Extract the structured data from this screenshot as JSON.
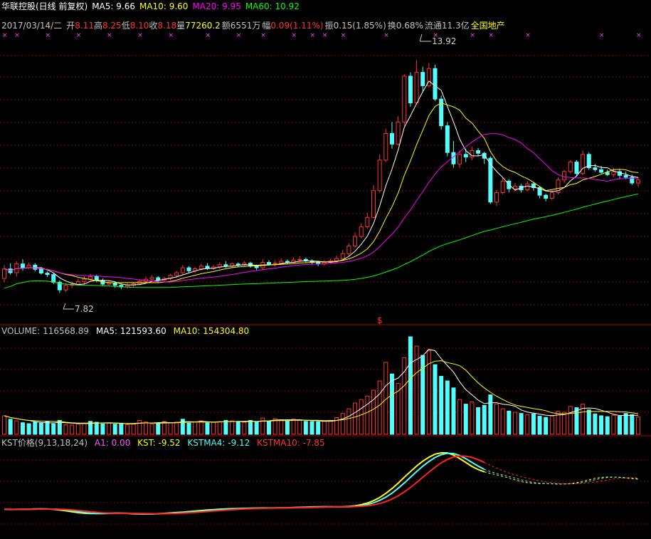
{
  "colors": {
    "up": "#ff3232",
    "down": "#54fcfc",
    "ma5": "#ffffff",
    "ma10": "#ffff00",
    "ma20": "#ff00ff",
    "ma60": "#00ff00",
    "grid": "#8a0000",
    "sep": "#b00000",
    "kst": "#ffff00",
    "kstma4": "#54fcfc",
    "kstma10": "#ff2020",
    "a1": "#ff55ff"
  },
  "header": {
    "stock_name": "华联控股(日线 前复权)",
    "ma5_label": "MA5:",
    "ma5_value": "9.66",
    "ma10_label": "MA10:",
    "ma10_value": "9.60",
    "ma20_label": "MA20:",
    "ma20_value": "9.95",
    "ma60_label": "MA60:",
    "ma60_value": "10.92"
  },
  "info_bar": {
    "date": "2017/03/14/二",
    "open_label": "开",
    "open": "8.11",
    "high_label": "高",
    "high": "8.25",
    "low_label": "低",
    "low": "8.10",
    "close_label": "收",
    "close": "8.18",
    "vol_label": "量",
    "vol": "77260.2",
    "amount": "额6551万",
    "change_label": "幅",
    "change": "0.09(1.11%)",
    "amplitude": "振0.15(1.85%)",
    "turnover": "换0.68%",
    "float": "流通11.3亿",
    "sector": "全国地产"
  },
  "volume_header": {
    "label": "VOLUME: 116568.89",
    "ma5": "MA5: 121593.60",
    "ma10": "MA10: 154304.80"
  },
  "kst_header": {
    "label": "KST价格(9,13,18,24)",
    "a1": "A1: 0.00",
    "kst": "KST: -9.52",
    "kstma4": "KSTMA4: -9.12",
    "kstma10": "KSTMA10: -7.85"
  },
  "annotations": {
    "max_label": "13.92",
    "min_label": "7.82",
    "signal_symbol": "$"
  },
  "chart_data": {
    "type": "candlestick",
    "price_range": [
      7.1,
      14.6
    ],
    "max_price": 13.92,
    "min_price": 7.82,
    "signals": [
      0,
      2,
      7,
      12,
      17,
      22,
      27,
      33,
      38,
      42,
      47,
      50,
      52,
      55,
      62,
      70,
      76,
      79,
      85,
      97,
      103
    ],
    "candles": [
      [
        8.2,
        8.45,
        8.55,
        8.1
      ],
      [
        8.45,
        8.35,
        8.6,
        8.3
      ],
      [
        8.35,
        8.58,
        8.65,
        8.25
      ],
      [
        8.58,
        8.48,
        8.7,
        8.4
      ],
      [
        8.48,
        8.55,
        8.62,
        8.44
      ],
      [
        8.55,
        8.44,
        8.6,
        8.38
      ],
      [
        8.44,
        8.34,
        8.5,
        8.3
      ],
      [
        8.34,
        8.3,
        8.38,
        8.24
      ],
      [
        8.3,
        8.1,
        8.35,
        8.05
      ],
      [
        8.1,
        7.9,
        8.15,
        7.82
      ],
      [
        7.9,
        8.02,
        8.08,
        7.85
      ],
      [
        8.02,
        8.05,
        8.12,
        7.95
      ],
      [
        8.05,
        8.12,
        8.2,
        8.0
      ],
      [
        8.12,
        8.18,
        8.25,
        8.05
      ],
      [
        8.18,
        8.25,
        8.32,
        8.12
      ],
      [
        8.25,
        8.15,
        8.3,
        8.1
      ],
      [
        8.15,
        8.05,
        8.2,
        8.0
      ],
      [
        8.05,
        8.08,
        8.15,
        8.0
      ],
      [
        8.08,
        8.02,
        8.12,
        7.96
      ],
      [
        8.02,
        7.98,
        8.06,
        7.92
      ],
      [
        7.98,
        8.02,
        8.08,
        7.93
      ],
      [
        8.02,
        8.06,
        8.1,
        7.98
      ],
      [
        8.06,
        8.12,
        8.18,
        8.02
      ],
      [
        8.12,
        8.18,
        8.25,
        8.1
      ],
      [
        8.18,
        8.22,
        8.28,
        8.12
      ],
      [
        8.22,
        8.15,
        8.26,
        8.1
      ],
      [
        8.15,
        8.2,
        8.25,
        8.12
      ],
      [
        8.2,
        8.28,
        8.32,
        8.15
      ],
      [
        8.28,
        8.35,
        8.4,
        8.22
      ],
      [
        8.35,
        8.48,
        8.55,
        8.3
      ],
      [
        8.48,
        8.4,
        8.52,
        8.36
      ],
      [
        8.4,
        8.45,
        8.5,
        8.34
      ],
      [
        8.45,
        8.52,
        8.58,
        8.4
      ],
      [
        8.52,
        8.46,
        8.6,
        8.42
      ],
      [
        8.46,
        8.5,
        8.55,
        8.42
      ],
      [
        8.5,
        8.56,
        8.62,
        8.45
      ],
      [
        8.56,
        8.52,
        8.65,
        8.48
      ],
      [
        8.52,
        8.58,
        8.62,
        8.48
      ],
      [
        8.58,
        8.55,
        8.62,
        8.5
      ],
      [
        8.55,
        8.6,
        8.66,
        8.52
      ],
      [
        8.6,
        8.52,
        8.64,
        8.48
      ],
      [
        8.52,
        8.48,
        8.56,
        8.4
      ],
      [
        8.48,
        8.62,
        8.7,
        8.42
      ],
      [
        8.62,
        8.58,
        8.68,
        8.54
      ],
      [
        8.58,
        8.6,
        8.66,
        8.52
      ],
      [
        8.6,
        8.65,
        8.72,
        8.56
      ],
      [
        8.65,
        8.62,
        8.7,
        8.58
      ],
      [
        8.62,
        8.68,
        8.75,
        8.6
      ],
      [
        8.68,
        8.7,
        8.78,
        8.64
      ],
      [
        8.7,
        8.66,
        8.75,
        8.62
      ],
      [
        8.66,
        8.62,
        8.7,
        8.56
      ],
      [
        8.62,
        8.58,
        8.66,
        8.52
      ],
      [
        8.58,
        8.62,
        8.68,
        8.54
      ],
      [
        8.62,
        8.66,
        8.72,
        8.58
      ],
      [
        8.66,
        8.72,
        8.8,
        8.62
      ],
      [
        8.72,
        8.85,
        8.95,
        8.7
      ],
      [
        8.85,
        9.05,
        9.12,
        8.8
      ],
      [
        9.05,
        9.3,
        9.4,
        9.0
      ],
      [
        9.3,
        9.55,
        9.65,
        9.25
      ],
      [
        9.55,
        9.8,
        9.92,
        9.5
      ],
      [
        9.8,
        10.5,
        10.65,
        9.78
      ],
      [
        10.5,
        11.3,
        11.45,
        10.45
      ],
      [
        11.3,
        12.0,
        12.12,
        11.25
      ],
      [
        12.0,
        11.72,
        12.3,
        11.6
      ],
      [
        11.72,
        12.3,
        12.45,
        11.68
      ],
      [
        12.3,
        13.5,
        13.55,
        12.2
      ],
      [
        13.5,
        12.8,
        13.6,
        12.7
      ],
      [
        12.8,
        13.6,
        13.92,
        12.75
      ],
      [
        13.6,
        13.25,
        13.75,
        13.1
      ],
      [
        13.25,
        13.7,
        13.85,
        13.2
      ],
      [
        13.7,
        12.9,
        13.8,
        12.85
      ],
      [
        12.9,
        12.2,
        13.0,
        12.1
      ],
      [
        12.2,
        11.5,
        12.3,
        11.4
      ],
      [
        11.5,
        11.2,
        11.8,
        11.1
      ],
      [
        11.2,
        11.45,
        11.55,
        11.1
      ],
      [
        11.45,
        11.38,
        11.6,
        11.25
      ],
      [
        11.38,
        11.55,
        11.65,
        11.3
      ],
      [
        11.55,
        11.48,
        11.62,
        11.4
      ],
      [
        11.48,
        11.35,
        11.52,
        11.2
      ],
      [
        11.35,
        10.2,
        11.4,
        10.15
      ],
      [
        10.2,
        10.45,
        10.52,
        10.1
      ],
      [
        10.45,
        10.75,
        10.85,
        10.4
      ],
      [
        10.75,
        10.55,
        10.8,
        10.45
      ],
      [
        10.55,
        10.62,
        10.7,
        10.48
      ],
      [
        10.62,
        10.52,
        10.68,
        10.45
      ],
      [
        10.52,
        10.68,
        10.75,
        10.48
      ],
      [
        10.68,
        10.58,
        10.72,
        10.5
      ],
      [
        10.58,
        10.38,
        10.62,
        10.3
      ],
      [
        10.38,
        10.3,
        10.42,
        10.22
      ],
      [
        10.3,
        10.45,
        10.5,
        10.25
      ],
      [
        10.45,
        10.78,
        10.85,
        10.4
      ],
      [
        10.78,
        11.0,
        11.05,
        10.7
      ],
      [
        11.0,
        11.25,
        11.3,
        10.95
      ],
      [
        11.25,
        10.95,
        11.3,
        10.9
      ],
      [
        10.95,
        11.45,
        11.55,
        10.9
      ],
      [
        11.45,
        11.1,
        11.5,
        11.05
      ],
      [
        11.1,
        11.05,
        11.2,
        11.0
      ],
      [
        11.05,
        10.98,
        11.15,
        10.95
      ],
      [
        10.98,
        10.92,
        11.05,
        10.88
      ],
      [
        10.92,
        11.0,
        11.1,
        10.85
      ],
      [
        11.0,
        10.9,
        11.05,
        10.8
      ],
      [
        10.9,
        10.85,
        11.0,
        10.8
      ],
      [
        10.85,
        10.7,
        10.92,
        10.65
      ],
      [
        10.7,
        10.78,
        10.85,
        10.6
      ]
    ],
    "volumes": [
      [
        8.0,
        1
      ],
      [
        6.5,
        -1
      ],
      [
        5.8,
        1
      ],
      [
        5.0,
        -1
      ],
      [
        4.6,
        -1
      ],
      [
        5.2,
        -1
      ],
      [
        4.8,
        -1
      ],
      [
        5.5,
        -1
      ],
      [
        4.5,
        -1
      ],
      [
        6.0,
        -1
      ],
      [
        4.2,
        1
      ],
      [
        4.0,
        1
      ],
      [
        4.5,
        1
      ],
      [
        4.8,
        1
      ],
      [
        5.6,
        -1
      ],
      [
        5.2,
        -1
      ],
      [
        4.5,
        -1
      ],
      [
        4.9,
        1
      ],
      [
        4.4,
        -1
      ],
      [
        4.8,
        -1
      ],
      [
        4.1,
        1
      ],
      [
        4.5,
        1
      ],
      [
        6.0,
        1
      ],
      [
        5.3,
        1
      ],
      [
        4.4,
        1
      ],
      [
        4.9,
        -1
      ],
      [
        5.5,
        1
      ],
      [
        5.0,
        1
      ],
      [
        5.3,
        1
      ],
      [
        6.5,
        -1
      ],
      [
        4.8,
        -1
      ],
      [
        5.3,
        1
      ],
      [
        5.8,
        1
      ],
      [
        4.9,
        -1
      ],
      [
        5.2,
        1
      ],
      [
        5.5,
        1
      ],
      [
        6.0,
        -1
      ],
      [
        5.8,
        1
      ],
      [
        5.4,
        -1
      ],
      [
        5.2,
        1
      ],
      [
        6.0,
        -1
      ],
      [
        5.4,
        -1
      ],
      [
        7.0,
        1
      ],
      [
        5.6,
        -1
      ],
      [
        6.8,
        1
      ],
      [
        6.3,
        1
      ],
      [
        5.7,
        -1
      ],
      [
        6.6,
        1
      ],
      [
        6.1,
        1
      ],
      [
        5.6,
        -1
      ],
      [
        5.5,
        -1
      ],
      [
        5.4,
        -1
      ],
      [
        5.6,
        1
      ],
      [
        6.0,
        1
      ],
      [
        7.2,
        1
      ],
      [
        9.0,
        1
      ],
      [
        11.0,
        1
      ],
      [
        13.5,
        1
      ],
      [
        15.0,
        1
      ],
      [
        16.5,
        1
      ],
      [
        19.0,
        1
      ],
      [
        23.0,
        1
      ],
      [
        31.0,
        1
      ],
      [
        26.0,
        -1
      ],
      [
        22.0,
        1
      ],
      [
        33.0,
        1
      ],
      [
        42.0,
        -1
      ],
      [
        38.0,
        1
      ],
      [
        34.0,
        -1
      ],
      [
        36.0,
        1
      ],
      [
        30.0,
        -1
      ],
      [
        25.0,
        -1
      ],
      [
        23.0,
        -1
      ],
      [
        20.0,
        -1
      ],
      [
        15.0,
        1
      ],
      [
        13.0,
        -1
      ],
      [
        14.0,
        1
      ],
      [
        11.5,
        -1
      ],
      [
        12.5,
        -1
      ],
      [
        17.0,
        -1
      ],
      [
        13.0,
        1
      ],
      [
        11.0,
        1
      ],
      [
        10.0,
        -1
      ],
      [
        9.5,
        1
      ],
      [
        9.0,
        -1
      ],
      [
        8.4,
        1
      ],
      [
        8.8,
        -1
      ],
      [
        7.8,
        -1
      ],
      [
        7.3,
        -1
      ],
      [
        7.9,
        1
      ],
      [
        10.0,
        1
      ],
      [
        9.5,
        1
      ],
      [
        12.0,
        1
      ],
      [
        11.5,
        -1
      ],
      [
        13.0,
        1
      ],
      [
        10.5,
        -1
      ],
      [
        8.8,
        -1
      ],
      [
        8.0,
        -1
      ],
      [
        7.6,
        -1
      ],
      [
        8.2,
        1
      ],
      [
        7.8,
        -1
      ],
      [
        9.0,
        -1
      ],
      [
        8.5,
        -1
      ],
      [
        7.5,
        1
      ]
    ]
  }
}
